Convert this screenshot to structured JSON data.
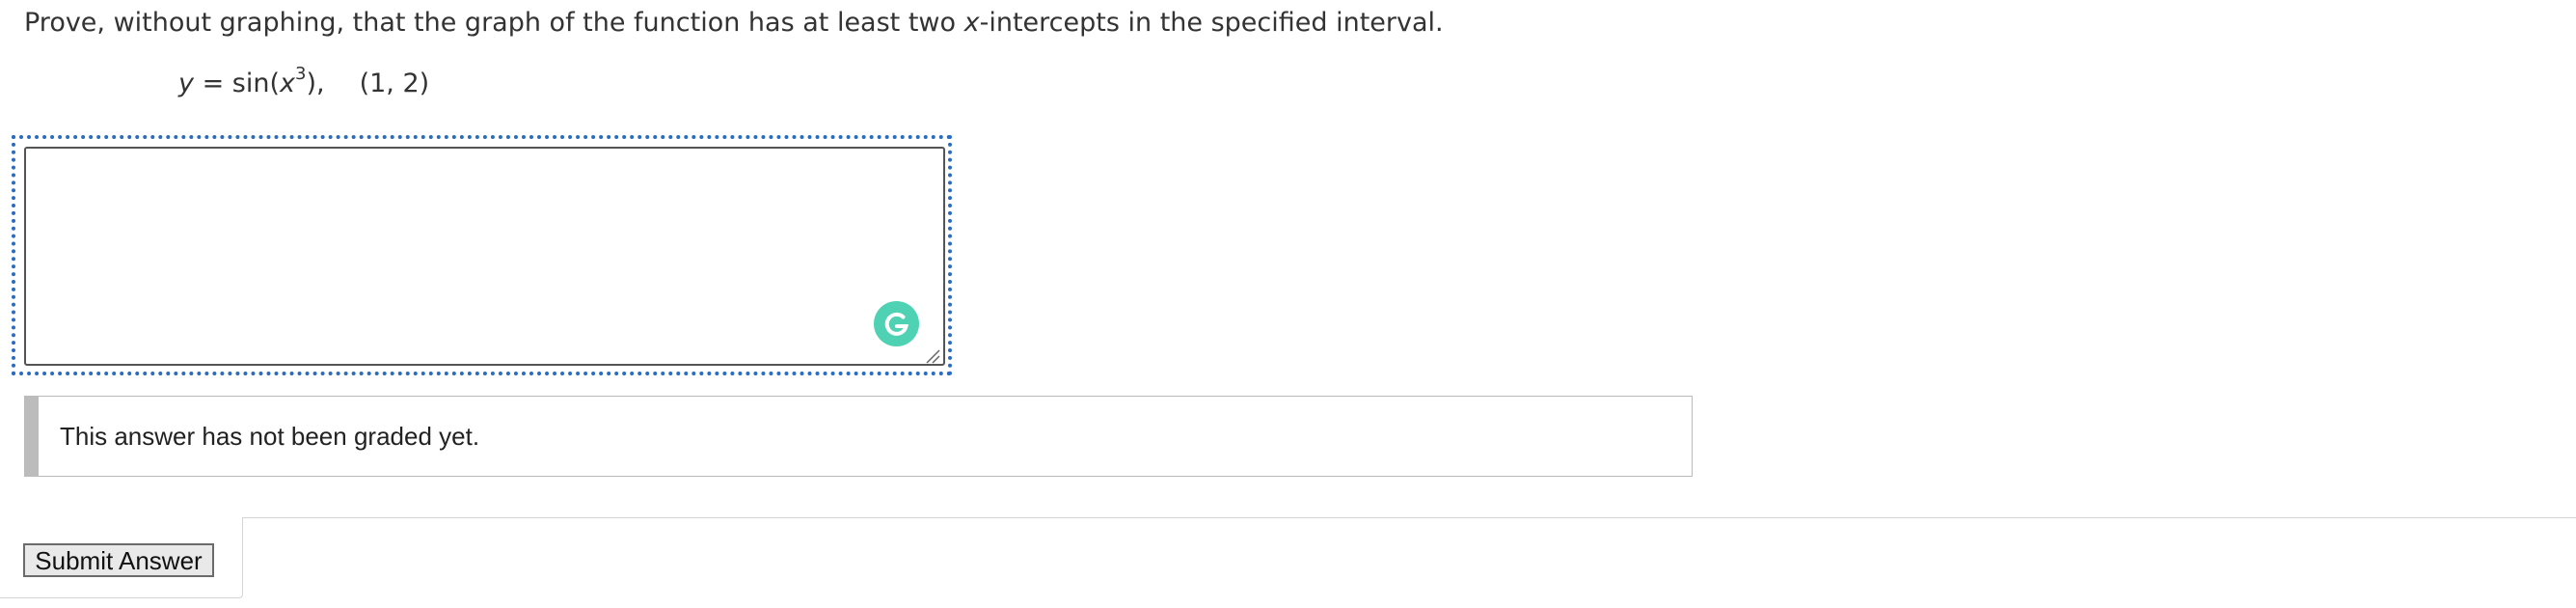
{
  "question": {
    "text_before": "Prove, without graphing, that the graph of the function has at least two ",
    "var_x": "x",
    "text_after": "-intercepts in the specified interval."
  },
  "equation": {
    "lhs": "y",
    "equals": " = sin(",
    "var": "x",
    "exponent": "3",
    "close": "),",
    "interval": "(1, 2)"
  },
  "answer": {
    "value": "",
    "placeholder": ""
  },
  "grading": {
    "message": "This answer has not been graded yet."
  },
  "submit": {
    "label": "Submit Answer"
  },
  "colors": {
    "focus_ring": "#2a6cc0",
    "grammarly": "#15c39a",
    "grading_bar": "#bcbcbc"
  },
  "icons": {
    "grammarly": "grammarly-icon",
    "resize": "resize-handle-icon"
  }
}
